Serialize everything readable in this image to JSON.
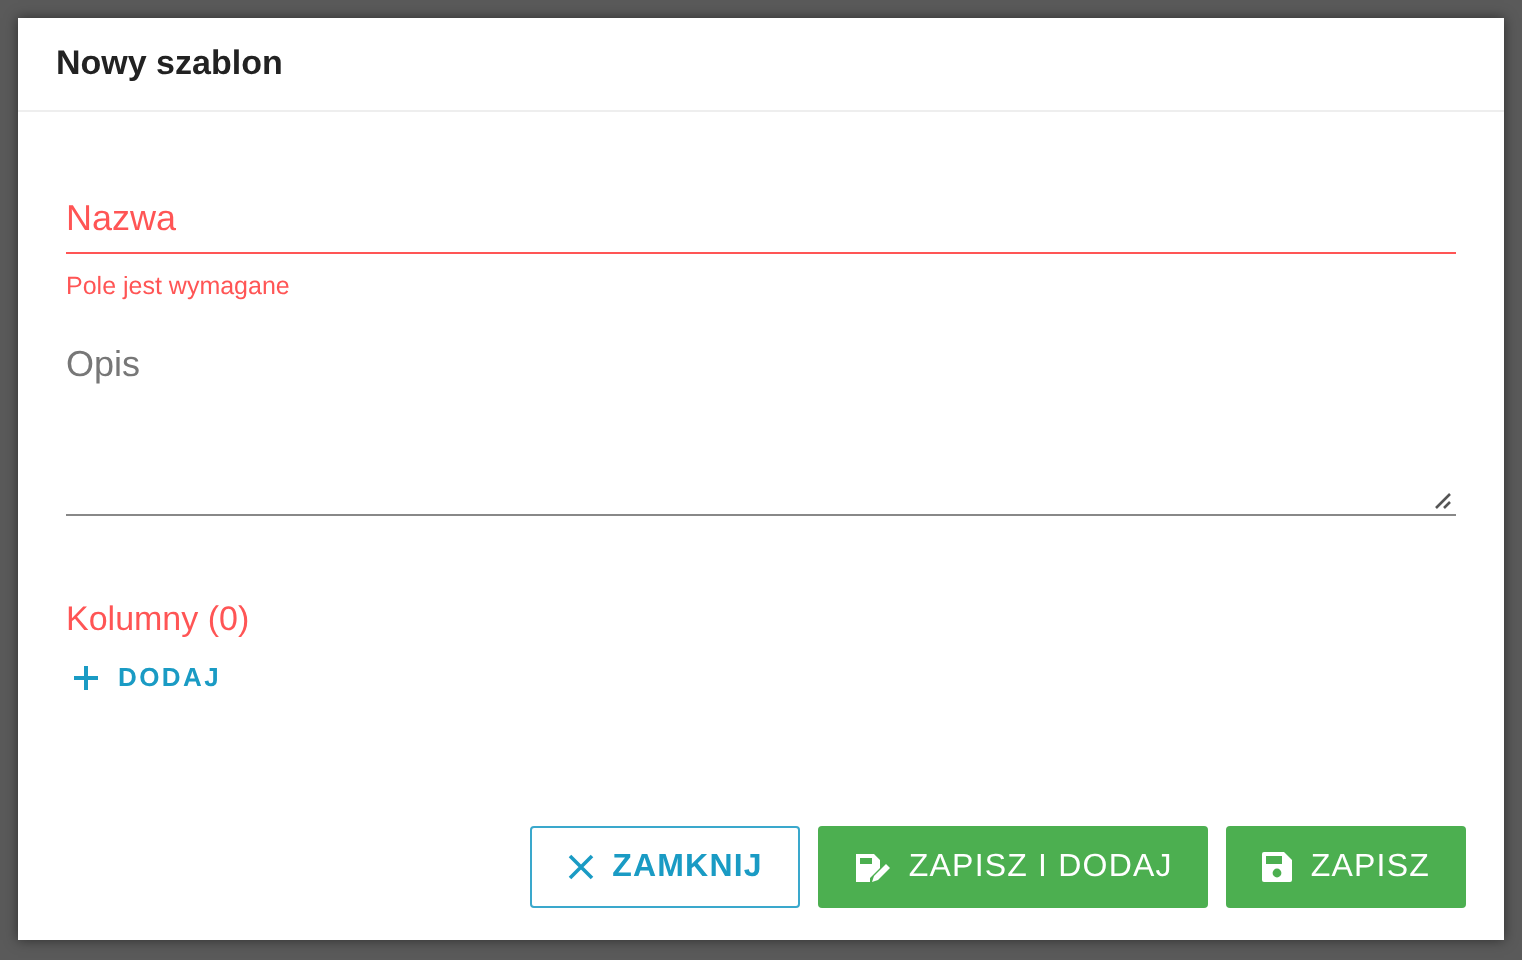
{
  "dialog": {
    "title": "Nowy szablon"
  },
  "fields": [
    {
      "kind": "input",
      "label": "Nazwa",
      "invalid": true,
      "error": "Pole jest wymagane"
    },
    {
      "kind": "textarea",
      "label": "Opis",
      "invalid": false
    }
  ],
  "columns": {
    "heading": "Kolumny (0)",
    "invalid": true,
    "add_button": "DODAJ"
  },
  "buttons": [
    {
      "kind": "close",
      "label": "ZAMKNIJ"
    },
    {
      "kind": "save-add",
      "label": "ZAPISZ I DODAJ"
    },
    {
      "kind": "save",
      "label": "ZAPISZ"
    }
  ]
}
